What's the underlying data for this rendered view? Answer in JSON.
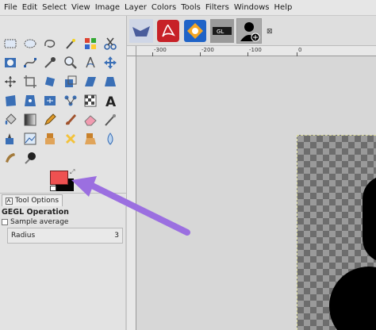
{
  "menu": [
    "File",
    "Edit",
    "Select",
    "View",
    "Image",
    "Layer",
    "Colors",
    "Tools",
    "Filters",
    "Windows",
    "Help"
  ],
  "toolbox": {
    "tools": [
      "rect-select-icon",
      "ellipse-select-icon",
      "free-select-icon",
      "fuzzy-select-icon",
      "by-color-select-icon",
      "scissors-select-icon",
      "foreground-select-icon",
      "paths-icon",
      "color-picker-icon",
      "zoom-icon",
      "measure-icon",
      "move-icon",
      "align-icon",
      "crop-icon",
      "rotate-icon",
      "scale-icon",
      "shear-icon",
      "perspective-icon",
      "unified-transform-icon",
      "handle-transform-icon",
      "cage-transform-icon",
      "flip-icon",
      "warp-transform-icon",
      "text-icon",
      "bucket-fill-icon",
      "gradient-icon",
      "pencil-icon",
      "paintbrush-icon",
      "eraser-icon",
      "airbrush-icon",
      "ink-icon",
      "mypaint-brush-icon",
      "clone-icon",
      "heal-icon",
      "perspective-clone-icon",
      "blur-sharpen-icon",
      "smudge-icon",
      "dodge-burn-icon"
    ],
    "colors": {
      "foreground": "#ee5151",
      "background": "#050505"
    }
  },
  "tool_options": {
    "tab_label": "Tool Options",
    "title": "GEGL Operation",
    "sample_average_label": "Sample average",
    "radius_label": "Radius",
    "radius_value": "3"
  },
  "image_tabs": [
    "image-thumb-1",
    "image-thumb-pdf",
    "image-thumb-3",
    "image-thumb-gl",
    "image-thumb-user"
  ],
  "ruler": {
    "labels": [
      "-300",
      "-200",
      "-100",
      "0"
    ]
  },
  "annotation": {
    "arrow_color": "#9b6fe0"
  }
}
